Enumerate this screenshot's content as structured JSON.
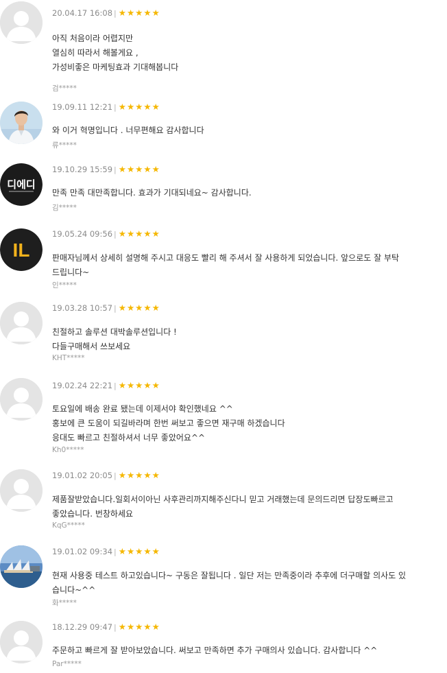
{
  "colors": {
    "star": "#f5b700",
    "meta": "#8a8a8a",
    "text": "#333333",
    "author": "#9a9a9a"
  },
  "reviews": [
    {
      "date": "20.04.17 16:08",
      "rating": 5,
      "avatar": "default-avatar-icon",
      "lines": [
        "아직 처음이라 어렵지만",
        "열심히 따라서 해볼게요 ,",
        "가성비좋은 마케팅효과 기대해봅니다"
      ],
      "author": "검*****"
    },
    {
      "date": "19.09.11 12:21",
      "rating": 5,
      "avatar": "person-photo-avatar",
      "lines": [
        "와 이거 혁명입니다 . 너무편해요 감사합니다"
      ],
      "author": "류*****"
    },
    {
      "date": "19.10.29 15:59",
      "rating": 5,
      "avatar": "logo-avatar",
      "avatar_text": "디에디",
      "lines": [
        "만족 만족 대만족합니다. 효과가 기대되네요~ 감사합니다."
      ],
      "author": "김*****"
    },
    {
      "date": "19.05.24 09:56",
      "rating": 5,
      "avatar": "logo-avatar",
      "avatar_text": "IL",
      "lines": [
        "판매자님께서 상세히 설명해 주시고 대응도 빨리 해 주셔서 잘 사용하게 되었습니다. 앞으로도 잘 부탁",
        "드립니다~"
      ],
      "author": "인*****"
    },
    {
      "date": "19.03.28 10:57",
      "rating": 5,
      "avatar": "default-avatar-icon",
      "lines": [
        "친절하고 솔루션 대박솔루션입니다 !",
        "다들구매해서 쓰보세요"
      ],
      "author": "KHT*****"
    },
    {
      "date": "19.02.24 22:21",
      "rating": 5,
      "avatar": "default-avatar-icon",
      "lines": [
        "토요일에 배송 완료 됐는데 이제서야 확인했네요 ^^",
        "홍보에 큰 도움이 되길바라며 한번 써보고 좋으면 재구매 하겠습니다",
        "응대도 빠르고 친절하셔서 너무 좋았어요^^"
      ],
      "author": "Kh0*****"
    },
    {
      "date": "19.01.02 20:05",
      "rating": 5,
      "avatar": "default-avatar-icon",
      "lines": [
        "제품잘받았습니다.일회서이아닌 사후관리까지해주신다니 믿고 거래했는데 문의드리면 답장도빠르고",
        "좋았습니다. 번창하세요"
      ],
      "author": "KqG*****"
    },
    {
      "date": "19.01.02 09:34",
      "rating": 5,
      "avatar": "landscape-photo-avatar",
      "lines": [
        "현재 사용중 테스트 하고있습니다~ 구동은 잘됩니다 . 일단 저는 만족중이라 추후에 더구매할 의사도 있",
        "습니다~^^"
      ],
      "author": "화*****"
    },
    {
      "date": "18.12.29 09:47",
      "rating": 5,
      "avatar": "default-avatar-icon",
      "lines": [
        "주문하고 빠르게 잘 받아보았습니다. 써보고 만족하면 추가 구매의사 있습니다. 감사합니다 ^^"
      ],
      "author": "Par*****"
    }
  ]
}
